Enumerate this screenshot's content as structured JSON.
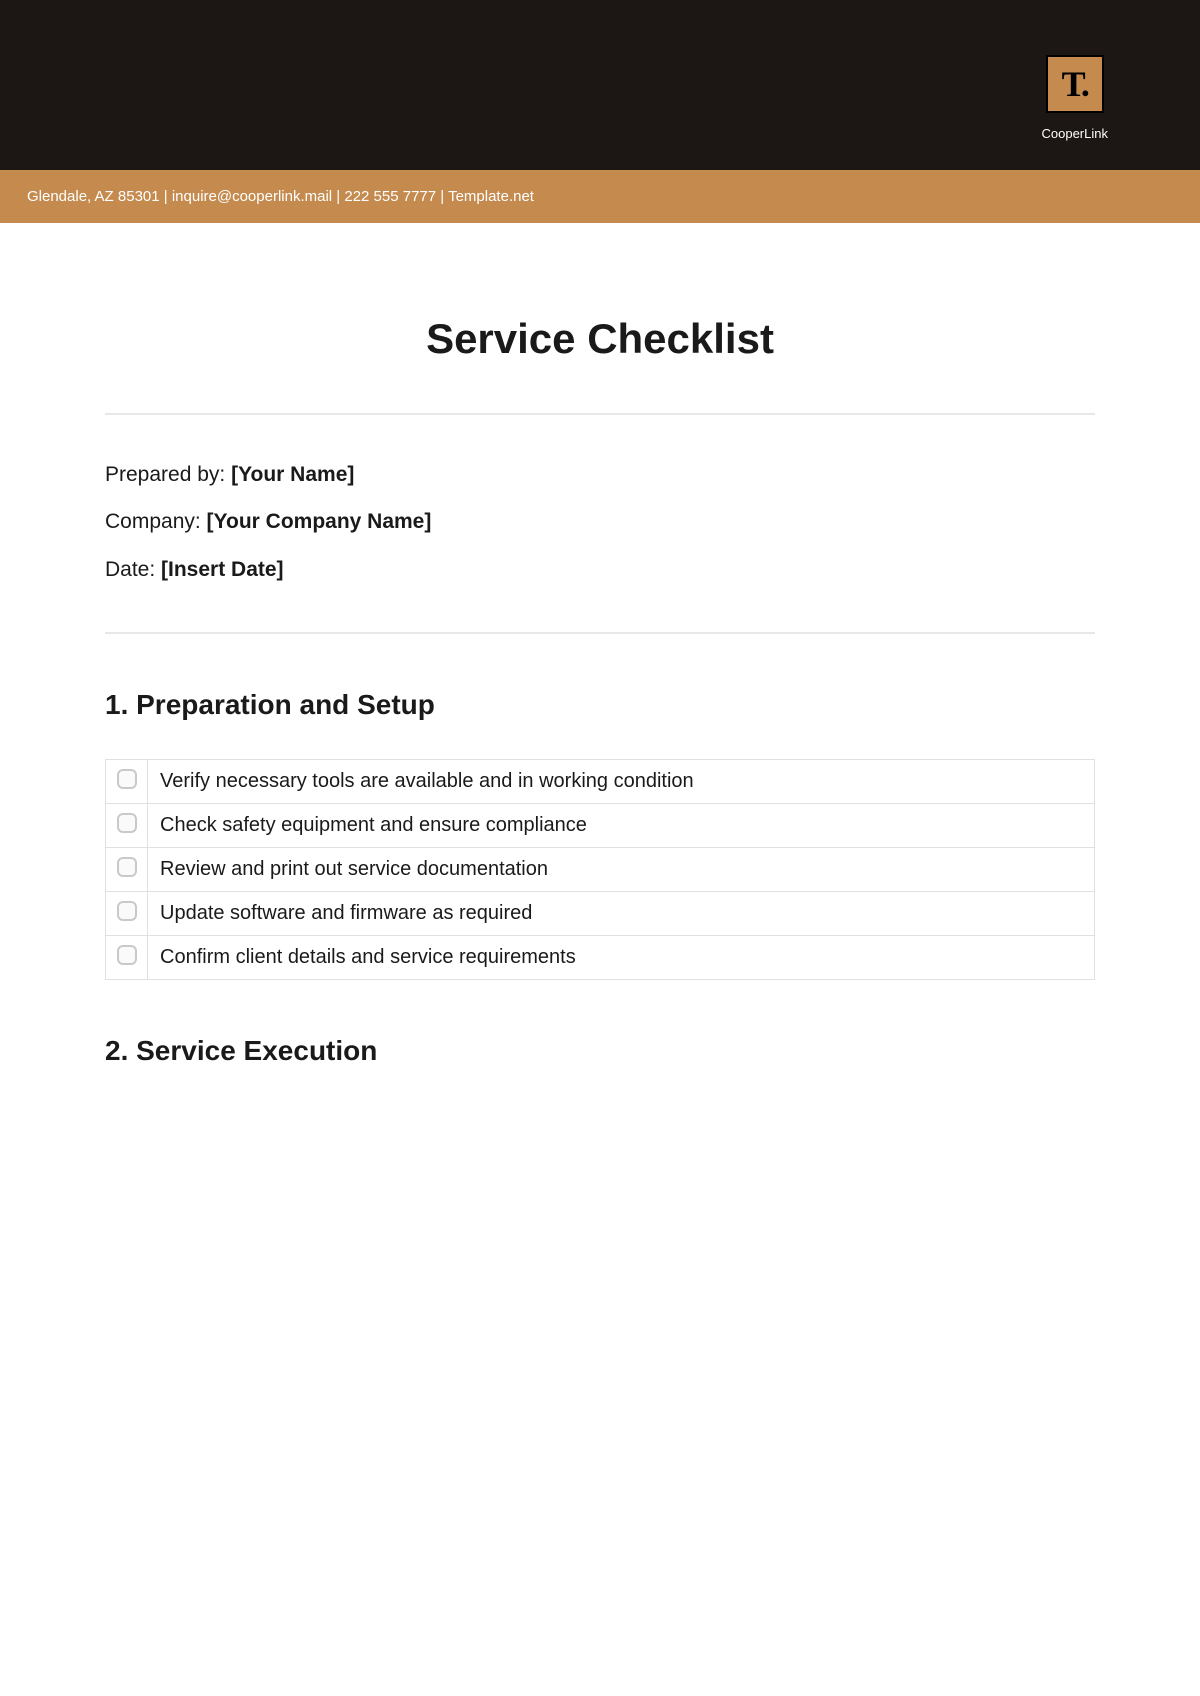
{
  "brand": {
    "logo_text": "T.",
    "name": "CooperLink"
  },
  "gold_bar": "Glendale, AZ 85301 | inquire@cooperlink.mail | 222 555 7777 | Template.net",
  "title": "Service Checklist",
  "meta": {
    "prepared_by_label": "Prepared by: ",
    "prepared_by_value": "[Your Name]",
    "company_label": "Company: ",
    "company_value": "[Your Company Name]",
    "date_label": "Date: ",
    "date_value": "[Insert Date]"
  },
  "sections": [
    {
      "heading": "1. Preparation and Setup",
      "items": [
        "Verify necessary tools are available and in working condition",
        "Check safety equipment and ensure compliance",
        "Review and print out service documentation",
        "Update software and firmware as required",
        "Confirm client details and service requirements"
      ]
    },
    {
      "heading": "2. Service Execution",
      "items": []
    }
  ]
}
